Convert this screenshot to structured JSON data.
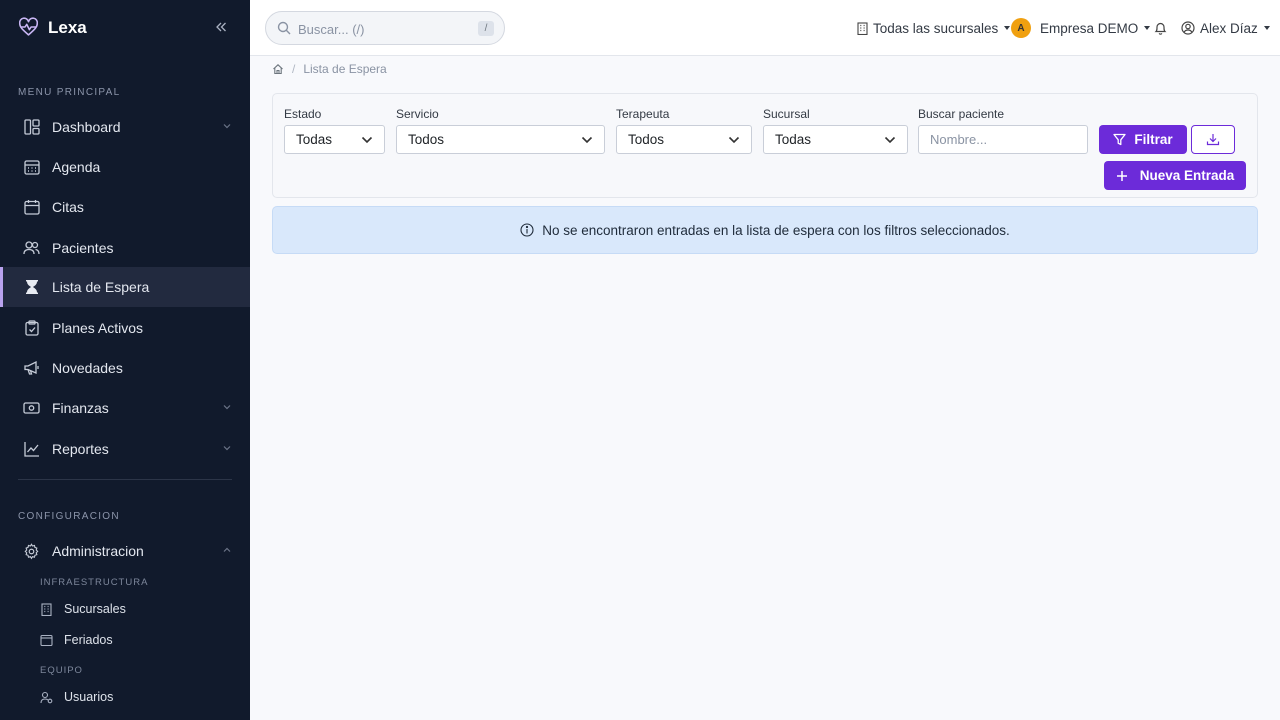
{
  "brand": {
    "name": "Lexa"
  },
  "sidebar": {
    "main_title": "MENU PRINCIPAL",
    "items": [
      {
        "label": "Dashboard"
      },
      {
        "label": "Agenda"
      },
      {
        "label": "Citas"
      },
      {
        "label": "Pacientes"
      },
      {
        "label": "Lista de Espera"
      },
      {
        "label": "Planes Activos"
      },
      {
        "label": "Novedades"
      },
      {
        "label": "Finanzas"
      },
      {
        "label": "Reportes"
      }
    ],
    "config_title": "CONFIGURACION",
    "admin_label": "Administracion",
    "infra_title": "INFRAESTRUCTURA",
    "infra_items": [
      {
        "label": "Sucursales"
      },
      {
        "label": "Feriados"
      }
    ],
    "team_title": "EQUIPO",
    "team_items": [
      {
        "label": "Usuarios"
      }
    ]
  },
  "topbar": {
    "search_placeholder": "Buscar... (/)",
    "search_shortcut": "/",
    "branch_selector": "Todas las sucursales",
    "company_initial": "A",
    "company": "Empresa DEMO",
    "user": "Alex Díaz"
  },
  "breadcrumb": {
    "current": "Lista de Espera"
  },
  "filters": {
    "estado_label": "Estado",
    "estado_value": "Todas",
    "servicio_label": "Servicio",
    "servicio_value": "Todos",
    "terapeuta_label": "Terapeuta",
    "terapeuta_value": "Todos",
    "sucursal_label": "Sucursal",
    "sucursal_value": "Todas",
    "buscar_label": "Buscar paciente",
    "buscar_placeholder": "Nombre...",
    "filtrar_label": "Filtrar",
    "nueva_entrada_label": "Nueva Entrada"
  },
  "alert": {
    "message": "No se encontraron entradas en la lista de espera con los filtros seleccionados."
  },
  "colors": {
    "sidebar_bg": "#111a2c",
    "accent": "#6c2bd9",
    "alert_bg": "#d9e8fb",
    "active_marker": "#b9a2ee"
  }
}
